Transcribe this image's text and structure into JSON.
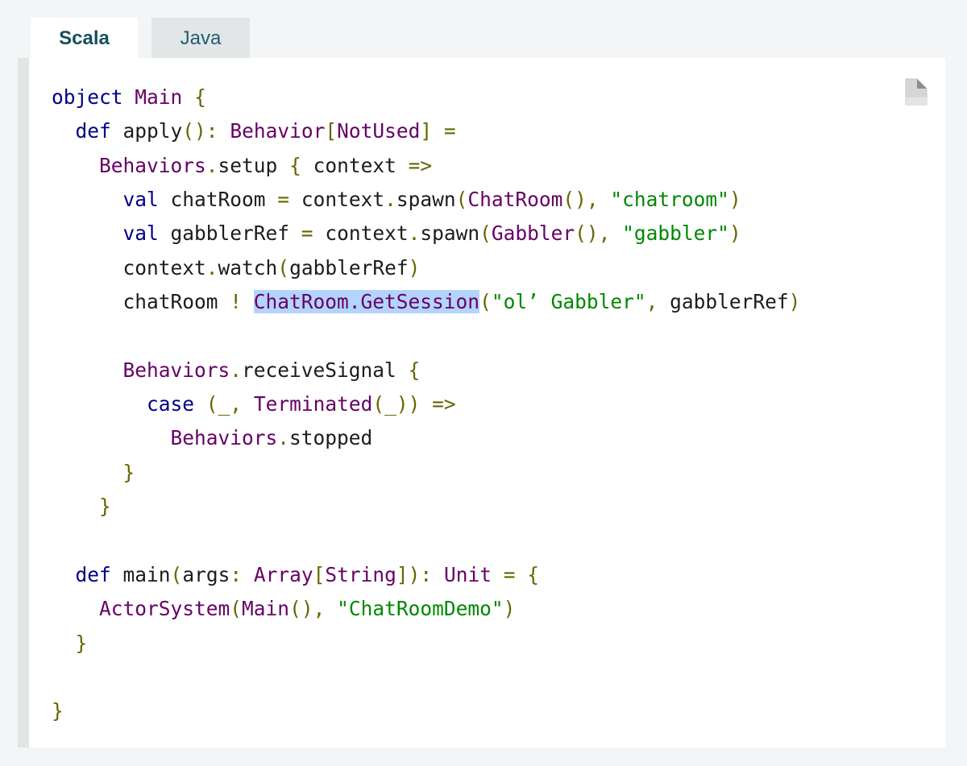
{
  "tabs": [
    {
      "label": "Scala",
      "active": true
    },
    {
      "label": "Java",
      "active": false
    }
  ],
  "copy_icon": "copy-file-icon",
  "colors": {
    "keyword": "#000088",
    "type": "#660066",
    "punctuation": "#666600",
    "string": "#008800",
    "plain": "#1c1c1c",
    "selection": "#b3d4fc"
  },
  "code": {
    "lines": [
      [
        {
          "t": "kw",
          "v": "object"
        },
        {
          "t": "pl",
          "v": " "
        },
        {
          "t": "ty",
          "v": "Main"
        },
        {
          "t": "pl",
          "v": " "
        },
        {
          "t": "pn",
          "v": "{"
        }
      ],
      [
        {
          "t": "pl",
          "v": "  "
        },
        {
          "t": "kw",
          "v": "def"
        },
        {
          "t": "pl",
          "v": " apply"
        },
        {
          "t": "pn",
          "v": "():"
        },
        {
          "t": "pl",
          "v": " "
        },
        {
          "t": "ty",
          "v": "Behavior"
        },
        {
          "t": "pn",
          "v": "["
        },
        {
          "t": "ty",
          "v": "NotUsed"
        },
        {
          "t": "pn",
          "v": "]"
        },
        {
          "t": "pl",
          "v": " "
        },
        {
          "t": "pn",
          "v": "="
        }
      ],
      [
        {
          "t": "pl",
          "v": "    "
        },
        {
          "t": "ty",
          "v": "Behaviors"
        },
        {
          "t": "pn",
          "v": "."
        },
        {
          "t": "pl",
          "v": "setup "
        },
        {
          "t": "pn",
          "v": "{"
        },
        {
          "t": "pl",
          "v": " context "
        },
        {
          "t": "pn",
          "v": "=>"
        }
      ],
      [
        {
          "t": "pl",
          "v": "      "
        },
        {
          "t": "kw",
          "v": "val"
        },
        {
          "t": "pl",
          "v": " chatRoom "
        },
        {
          "t": "pn",
          "v": "="
        },
        {
          "t": "pl",
          "v": " context"
        },
        {
          "t": "pn",
          "v": "."
        },
        {
          "t": "pl",
          "v": "spawn"
        },
        {
          "t": "pn",
          "v": "("
        },
        {
          "t": "ty",
          "v": "ChatRoom"
        },
        {
          "t": "pn",
          "v": "(),"
        },
        {
          "t": "pl",
          "v": " "
        },
        {
          "t": "st",
          "v": "\"chatroom\""
        },
        {
          "t": "pn",
          "v": ")"
        }
      ],
      [
        {
          "t": "pl",
          "v": "      "
        },
        {
          "t": "kw",
          "v": "val"
        },
        {
          "t": "pl",
          "v": " gabblerRef "
        },
        {
          "t": "pn",
          "v": "="
        },
        {
          "t": "pl",
          "v": " context"
        },
        {
          "t": "pn",
          "v": "."
        },
        {
          "t": "pl",
          "v": "spawn"
        },
        {
          "t": "pn",
          "v": "("
        },
        {
          "t": "ty",
          "v": "Gabbler"
        },
        {
          "t": "pn",
          "v": "(),"
        },
        {
          "t": "pl",
          "v": " "
        },
        {
          "t": "st",
          "v": "\"gabbler\""
        },
        {
          "t": "pn",
          "v": ")"
        }
      ],
      [
        {
          "t": "pl",
          "v": "      context"
        },
        {
          "t": "pn",
          "v": "."
        },
        {
          "t": "pl",
          "v": "watch"
        },
        {
          "t": "pn",
          "v": "("
        },
        {
          "t": "pl",
          "v": "gabblerRef"
        },
        {
          "t": "pn",
          "v": ")"
        }
      ],
      [
        {
          "t": "pl",
          "v": "      chatRoom "
        },
        {
          "t": "pn",
          "v": "!"
        },
        {
          "t": "pl",
          "v": " "
        },
        {
          "t": "ty",
          "v": "ChatRoom.GetSession",
          "hl": true
        },
        {
          "t": "pn",
          "v": "("
        },
        {
          "t": "st",
          "v": "\"ol’ Gabbler\""
        },
        {
          "t": "pn",
          "v": ","
        },
        {
          "t": "pl",
          "v": " gabblerRef"
        },
        {
          "t": "pn",
          "v": ")"
        }
      ],
      [],
      [
        {
          "t": "pl",
          "v": "      "
        },
        {
          "t": "ty",
          "v": "Behaviors"
        },
        {
          "t": "pn",
          "v": "."
        },
        {
          "t": "pl",
          "v": "receiveSignal "
        },
        {
          "t": "pn",
          "v": "{"
        }
      ],
      [
        {
          "t": "pl",
          "v": "        "
        },
        {
          "t": "kw",
          "v": "case"
        },
        {
          "t": "pl",
          "v": " "
        },
        {
          "t": "pn",
          "v": "(_,"
        },
        {
          "t": "pl",
          "v": " "
        },
        {
          "t": "ty",
          "v": "Terminated"
        },
        {
          "t": "pn",
          "v": "(_))"
        },
        {
          "t": "pl",
          "v": " "
        },
        {
          "t": "pn",
          "v": "=>"
        }
      ],
      [
        {
          "t": "pl",
          "v": "          "
        },
        {
          "t": "ty",
          "v": "Behaviors"
        },
        {
          "t": "pn",
          "v": "."
        },
        {
          "t": "pl",
          "v": "stopped"
        }
      ],
      [
        {
          "t": "pl",
          "v": "      "
        },
        {
          "t": "pn",
          "v": "}"
        }
      ],
      [
        {
          "t": "pl",
          "v": "    "
        },
        {
          "t": "pn",
          "v": "}"
        }
      ],
      [],
      [
        {
          "t": "pl",
          "v": "  "
        },
        {
          "t": "kw",
          "v": "def"
        },
        {
          "t": "pl",
          "v": " main"
        },
        {
          "t": "pn",
          "v": "("
        },
        {
          "t": "pl",
          "v": "args"
        },
        {
          "t": "pn",
          "v": ":"
        },
        {
          "t": "pl",
          "v": " "
        },
        {
          "t": "ty",
          "v": "Array"
        },
        {
          "t": "pn",
          "v": "["
        },
        {
          "t": "ty",
          "v": "String"
        },
        {
          "t": "pn",
          "v": "]):"
        },
        {
          "t": "pl",
          "v": " "
        },
        {
          "t": "ty",
          "v": "Unit"
        },
        {
          "t": "pl",
          "v": " "
        },
        {
          "t": "pn",
          "v": "="
        },
        {
          "t": "pl",
          "v": " "
        },
        {
          "t": "pn",
          "v": "{"
        }
      ],
      [
        {
          "t": "pl",
          "v": "    "
        },
        {
          "t": "ty",
          "v": "ActorSystem"
        },
        {
          "t": "pn",
          "v": "("
        },
        {
          "t": "ty",
          "v": "Main"
        },
        {
          "t": "pn",
          "v": "(),"
        },
        {
          "t": "pl",
          "v": " "
        },
        {
          "t": "st",
          "v": "\"ChatRoomDemo\""
        },
        {
          "t": "pn",
          "v": ")"
        }
      ],
      [
        {
          "t": "pl",
          "v": "  "
        },
        {
          "t": "pn",
          "v": "}"
        }
      ],
      [],
      [
        {
          "t": "pn",
          "v": "}"
        }
      ]
    ]
  }
}
